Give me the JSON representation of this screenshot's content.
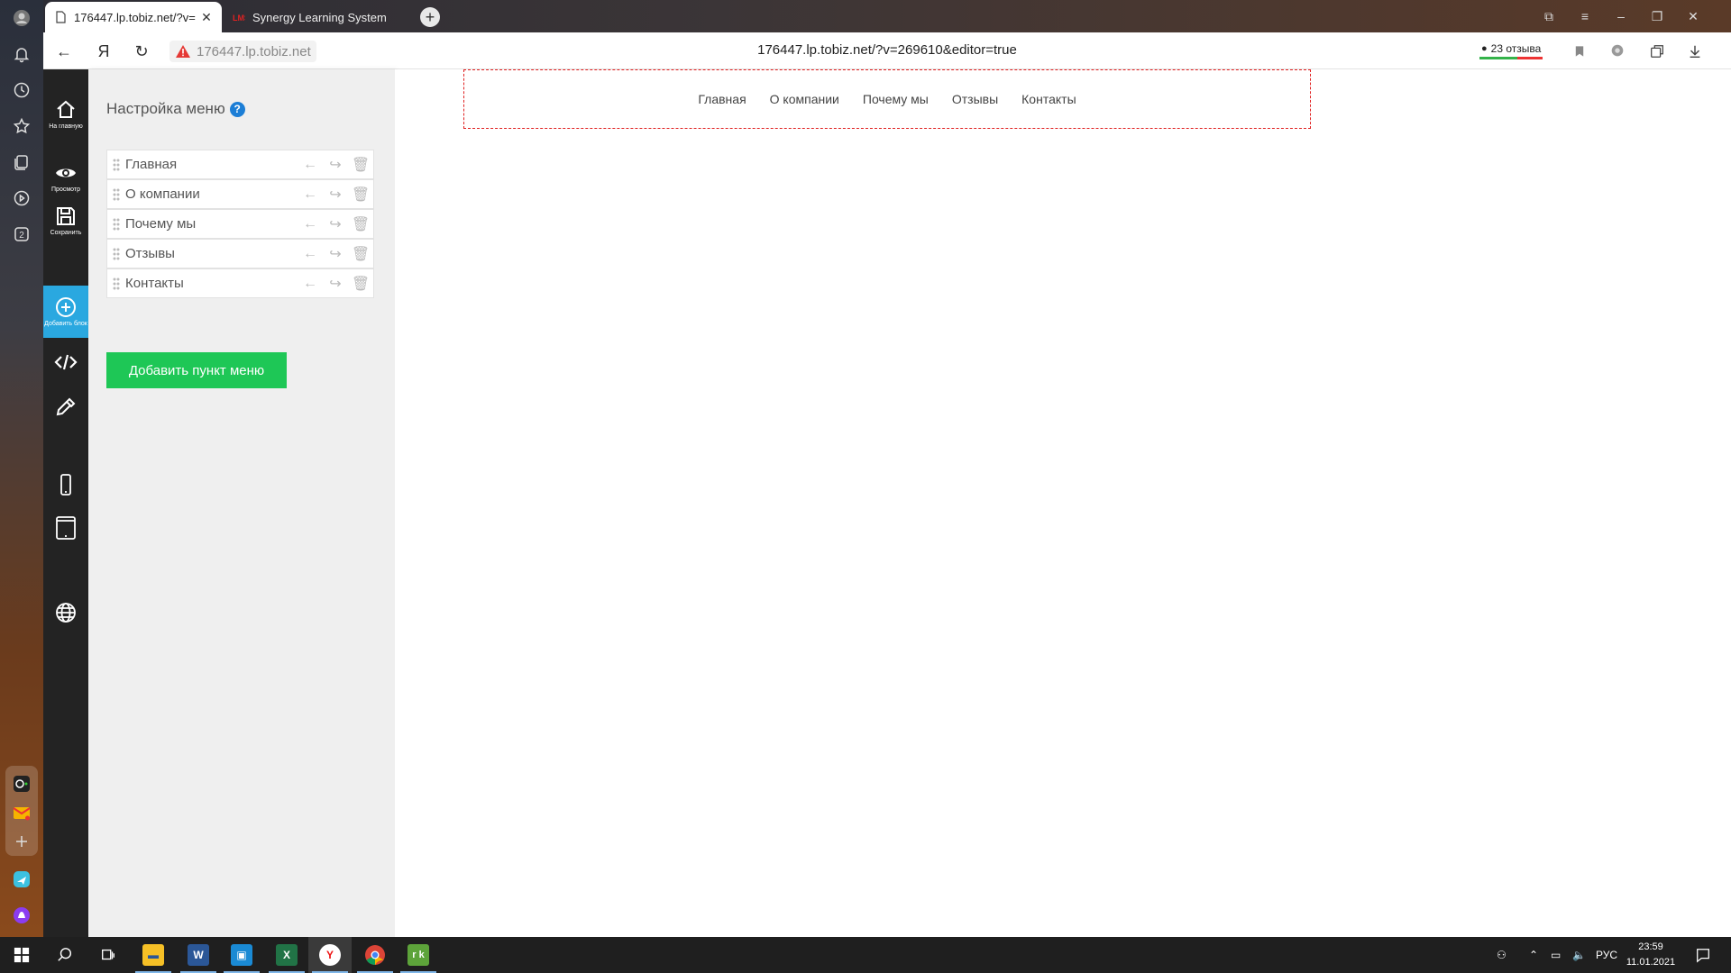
{
  "browser": {
    "tabs": [
      {
        "title": "176447.lp.tobiz.net/?v=",
        "active": true
      },
      {
        "title": "Synergy Learning System",
        "active": false
      }
    ],
    "host": "176447.lp.tobiz.net",
    "url": "176447.lp.tobiz.net/?v=269610&editor=true",
    "reviews_label": "23 отзыва"
  },
  "toolbar": {
    "home": "На главную",
    "preview": "Просмотр",
    "save": "Сохранить",
    "add_block": "Добавить блок"
  },
  "panel": {
    "title": "Настройка меню",
    "help": "?",
    "items": [
      {
        "label": "Главная"
      },
      {
        "label": "О компании"
      },
      {
        "label": "Почему мы"
      },
      {
        "label": "Отзывы"
      },
      {
        "label": "Контакты"
      }
    ],
    "add_button": "Добавить пункт меню"
  },
  "canvas": {
    "nav": [
      "Главная",
      "О компании",
      "Почему мы",
      "Отзывы",
      "Контакты"
    ]
  },
  "taskbar": {
    "lang": "РУС",
    "time": "23:59",
    "date": "11.01.2021"
  },
  "colors": {
    "accent_green": "#1ec756",
    "add_block_blue": "#2aa8e0",
    "help_blue": "#1c7ed6",
    "selection_red": "#e02020"
  }
}
